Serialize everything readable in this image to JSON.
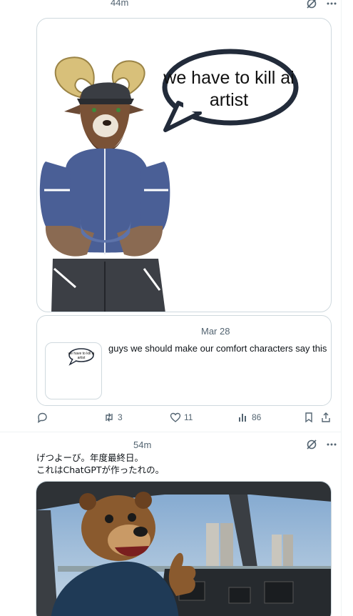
{
  "post1": {
    "time": "44m",
    "speech_bubble_text": [
      "we have to kill ai",
      "artist"
    ],
    "quote": {
      "date": "Mar 28",
      "text": "guys we should make our comfort characters say this",
      "thumb_bubble_text": [
        "we have to kill ai",
        "artist"
      ]
    },
    "actions": {
      "replies": "",
      "reposts": "3",
      "likes": "11",
      "views": "86"
    }
  },
  "post2": {
    "time": "54m",
    "text_line1": "げつよーび。年度最終日。",
    "text_line2": "これはChatGPTが作ったれの。"
  },
  "icons": {
    "grok": "grok-icon",
    "more": "more-icon",
    "reply": "reply-icon",
    "repost": "repost-icon",
    "like": "heart-icon",
    "views": "views-icon",
    "bookmark": "bookmark-icon",
    "share": "share-icon"
  },
  "colors": {
    "secondary_text": "#536471",
    "border": "#cfd9de",
    "shirt_blue": "#4a5f96"
  }
}
